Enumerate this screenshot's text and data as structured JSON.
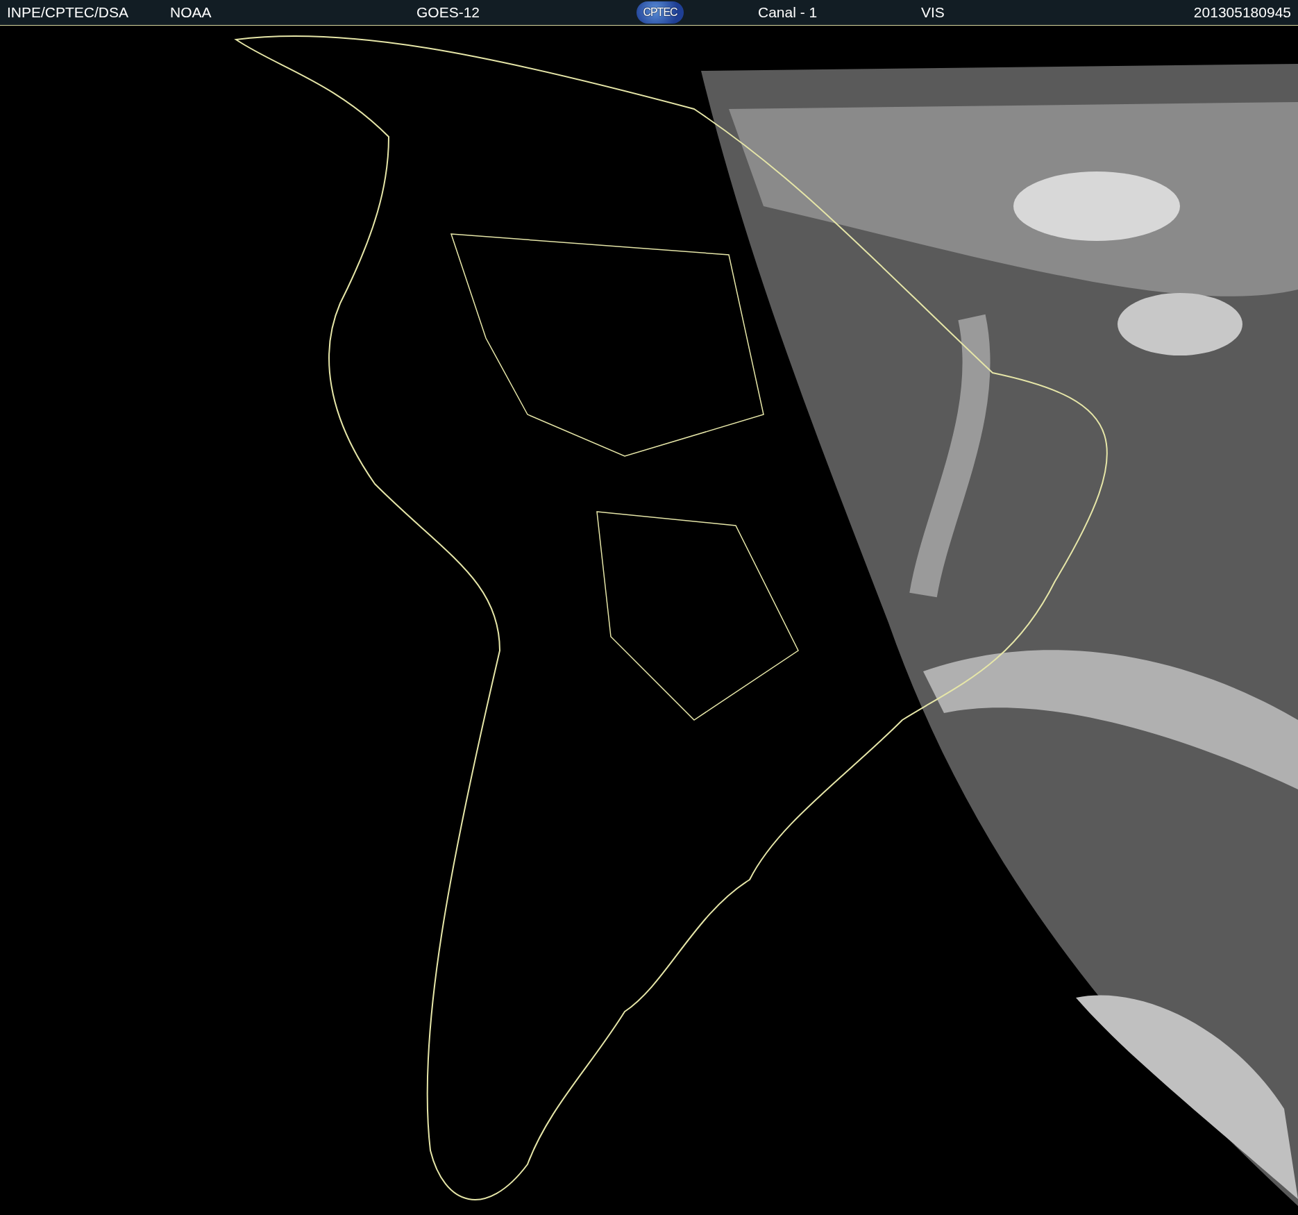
{
  "header": {
    "source": "INPE/CPTEC/DSA",
    "agency": "NOAA",
    "satellite": "GOES-12",
    "logo": "CPTEC",
    "channel": "Canal - 1",
    "band": "VIS",
    "timestamp": "201305180945"
  }
}
